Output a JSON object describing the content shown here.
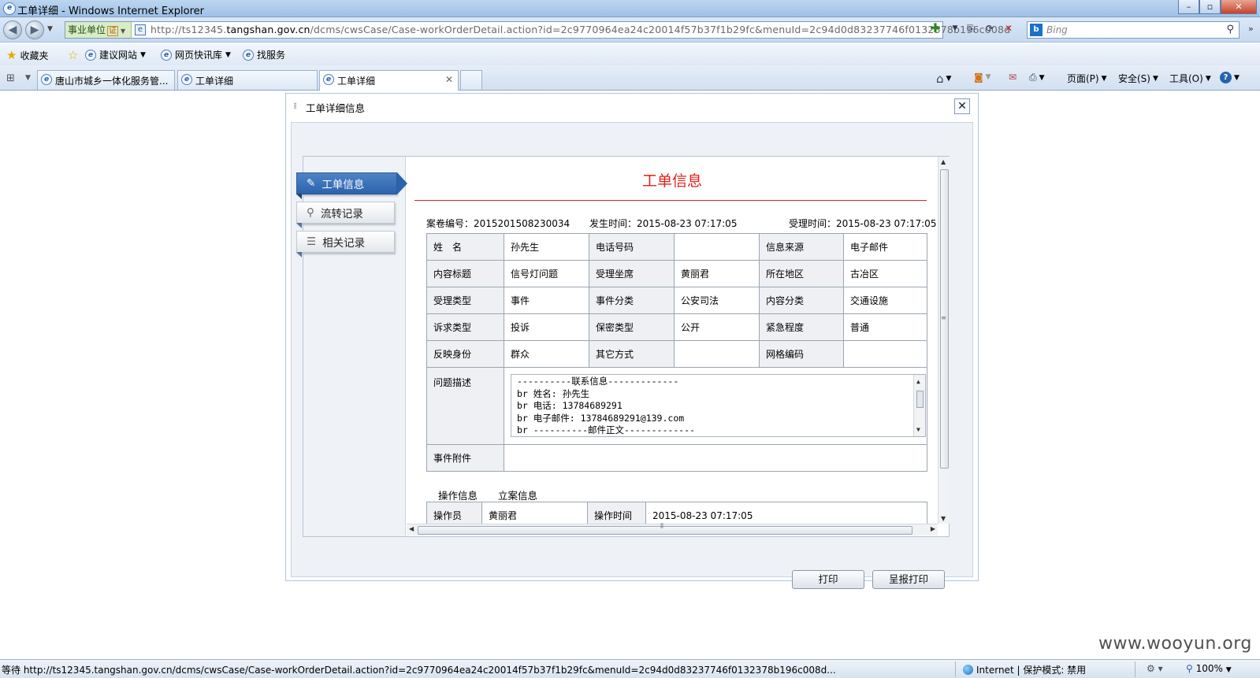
{
  "window": {
    "title": "工单详细 - Windows Internet Explorer",
    "controls": [
      "–",
      "▫",
      "✕"
    ]
  },
  "navbar": {
    "zone_label": "事业单位",
    "zone_badge": "证",
    "url_prefix": "http://ts12345.",
    "url_domain": "tangshan.gov.cn",
    "url_rest": "/dcms/cwsCase/Case-workOrderDetail.action?id=2c9770964ea24c20014f57b37f1b29fc&menuId=2c94d0d83237746f0132378b196c008d",
    "search_placeholder": "Bing"
  },
  "favorites": {
    "favorites_label": "收藏夹",
    "items": [
      "建议网站",
      "网页快讯库",
      "找服务"
    ]
  },
  "tabs": [
    {
      "label": "唐山市城乡一体化服务管..."
    },
    {
      "label": "工单详细"
    },
    {
      "label": "工单详细"
    }
  ],
  "commandbar": {
    "page": "页面(P)",
    "safety": "安全(S)",
    "tools": "工具(O)"
  },
  "dialog": {
    "title": "工单详细信息",
    "nav": [
      {
        "label": "工单信息",
        "icon": "edit-icon"
      },
      {
        "label": "流转记录",
        "icon": "search-icon"
      },
      {
        "label": "相关记录",
        "icon": "list-icon"
      }
    ],
    "heading": "工单信息",
    "meta": {
      "case_no": "案卷编号：2015201508230034",
      "occur_time": "发生时间：2015-08-23 07:17:05",
      "accept_time": "受理时间：2015-08-23 07:17:05"
    },
    "rows": [
      [
        "姓　名",
        "孙先生",
        "电话号码",
        "",
        "信息来源",
        "电子邮件"
      ],
      [
        "内容标题",
        "信号灯问题",
        "受理坐席",
        "黄丽君",
        "所在地区",
        "古冶区"
      ],
      [
        "受理类型",
        "事件",
        "事件分类",
        "公安司法",
        "内容分类",
        "交通设施"
      ],
      [
        "诉求类型",
        "投诉",
        "保密类型",
        "公开",
        "紧急程度",
        "普通"
      ],
      [
        "反映身份",
        "群众",
        "其它方式",
        "",
        "网格编码",
        ""
      ]
    ],
    "desc_label": "问题描述",
    "desc_lines": [
      "----------联系信息-------------",
      "br 姓名: 孙先生",
      "br 电话: 13784689291",
      "br 电子邮件: 13784689291@139.com",
      "br ----------邮件正文-------------"
    ],
    "attach_label": "事件附件",
    "op_tabs": [
      "操作信息",
      "立案信息"
    ],
    "op_row": [
      "操作员",
      "黄丽君",
      "操作时间",
      "2015-08-23 07:17:05"
    ],
    "buttons": {
      "print": "打印",
      "report_print": "呈报打印"
    }
  },
  "status": {
    "text": "等待 http://ts12345.tangshan.gov.cn/dcms/cwsCase/Case-workOrderDetail.action?id=2c9770964ea24c20014f57b37f1b29fc&menuId=2c94d0d83237746f0132378b196c008d...",
    "zone": "Internet | 保护模式: 禁用",
    "zoom": "100%"
  },
  "watermark": "www.wooyun.org"
}
